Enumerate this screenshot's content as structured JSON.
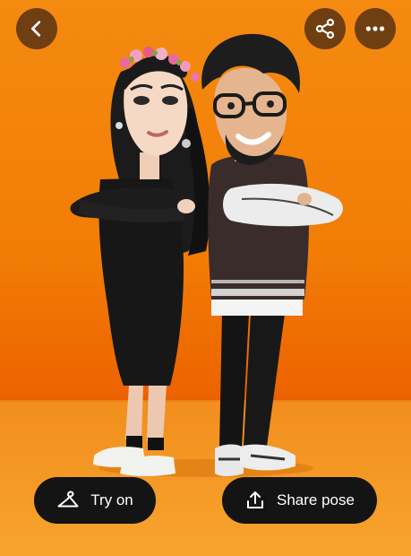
{
  "colors": {
    "background": "#f27d06",
    "floor": "#f7a42d",
    "button_bg": "#141414",
    "button_text": "#ffffff"
  },
  "top_bar": {
    "back_icon": "chevron-left-icon",
    "share_icon": "share-icon",
    "more_icon": "ellipsis-icon"
  },
  "actions": {
    "try_on": {
      "label": "Try on",
      "icon": "hanger-icon"
    },
    "share_pose": {
      "label": "Share pose",
      "icon": "upload-icon"
    }
  }
}
